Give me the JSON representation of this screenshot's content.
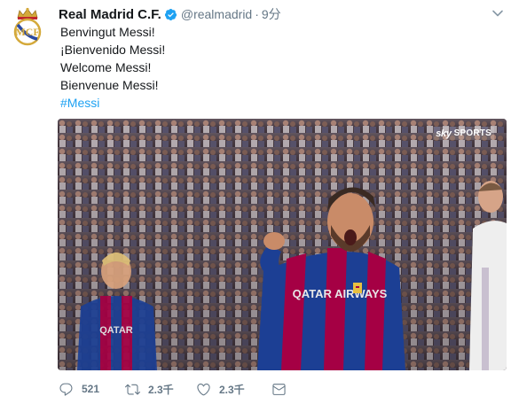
{
  "tweet": {
    "author": {
      "display_name": "Real Madrid C.F.",
      "handle": "@realmadrid",
      "verified": true,
      "avatar_icon": "real-madrid-crest"
    },
    "separator": "·",
    "time": "9分",
    "lines": [
      "Benvingut Messi!",
      "¡Bienvenido Messi!",
      "Welcome Messi!",
      "Bienvenue Messi!"
    ],
    "hashtag": "#Messi",
    "media": {
      "watermark_brand": "sky",
      "watermark_label": "SPORTS",
      "jersey_text": "QATAR AIRWAYS",
      "jersey_text_left": "QATAR"
    },
    "actions": {
      "reply": {
        "icon": "reply-icon",
        "count": "521"
      },
      "retweet": {
        "icon": "retweet-icon",
        "count": "2.3千"
      },
      "like": {
        "icon": "heart-icon",
        "count": "2.3千"
      },
      "message": {
        "icon": "envelope-icon"
      }
    },
    "colors": {
      "accent": "#1da1f2",
      "muted": "#657786",
      "text": "#14171a",
      "crest_gold": "#d4a93a",
      "barca_blue": "#1c3f94",
      "barca_red": "#a50044"
    }
  }
}
